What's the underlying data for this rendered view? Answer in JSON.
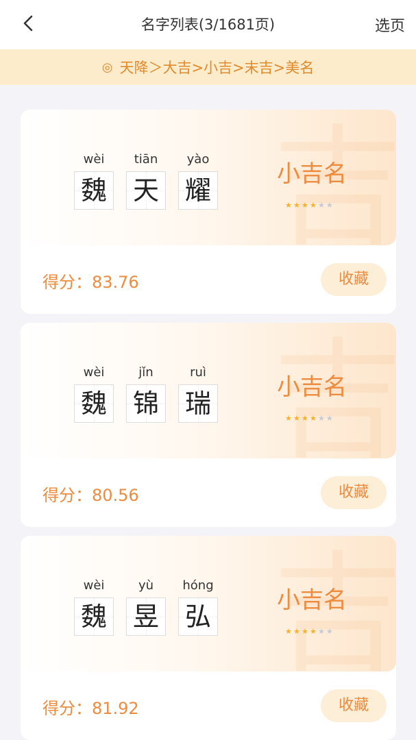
{
  "header": {
    "title": "名字列表(3/1681页)",
    "select_page_label": "选页"
  },
  "banner": {
    "icon": "◎",
    "text": "天降＞大吉>小吉>末吉>美名"
  },
  "cards": [
    {
      "pinyin": [
        "wèi",
        "tiān",
        "yào"
      ],
      "chars": [
        "魏",
        "天",
        "耀"
      ],
      "grade": "小吉名",
      "stars": 4,
      "score": "得分：83.76",
      "favorite": "收藏"
    },
    {
      "pinyin": [
        "wèi",
        "jǐn",
        "ruì"
      ],
      "chars": [
        "魏",
        "锦",
        "瑞"
      ],
      "grade": "小吉名",
      "stars": 4,
      "score": "得分：80.56",
      "favorite": "收藏"
    },
    {
      "pinyin": [
        "wèi",
        "yù",
        "hóng"
      ],
      "chars": [
        "魏",
        "昱",
        "弘"
      ],
      "grade": "小吉名",
      "stars": 4,
      "score": "得分：81.92",
      "favorite": "收藏"
    }
  ],
  "star_total": 6,
  "bg_glyph": "吉",
  "colors": {
    "accent": "#ed8b3f",
    "banner_bg": "#fdeccb",
    "star_on": "#f6b12c",
    "star_off": "#c6c9d6"
  }
}
